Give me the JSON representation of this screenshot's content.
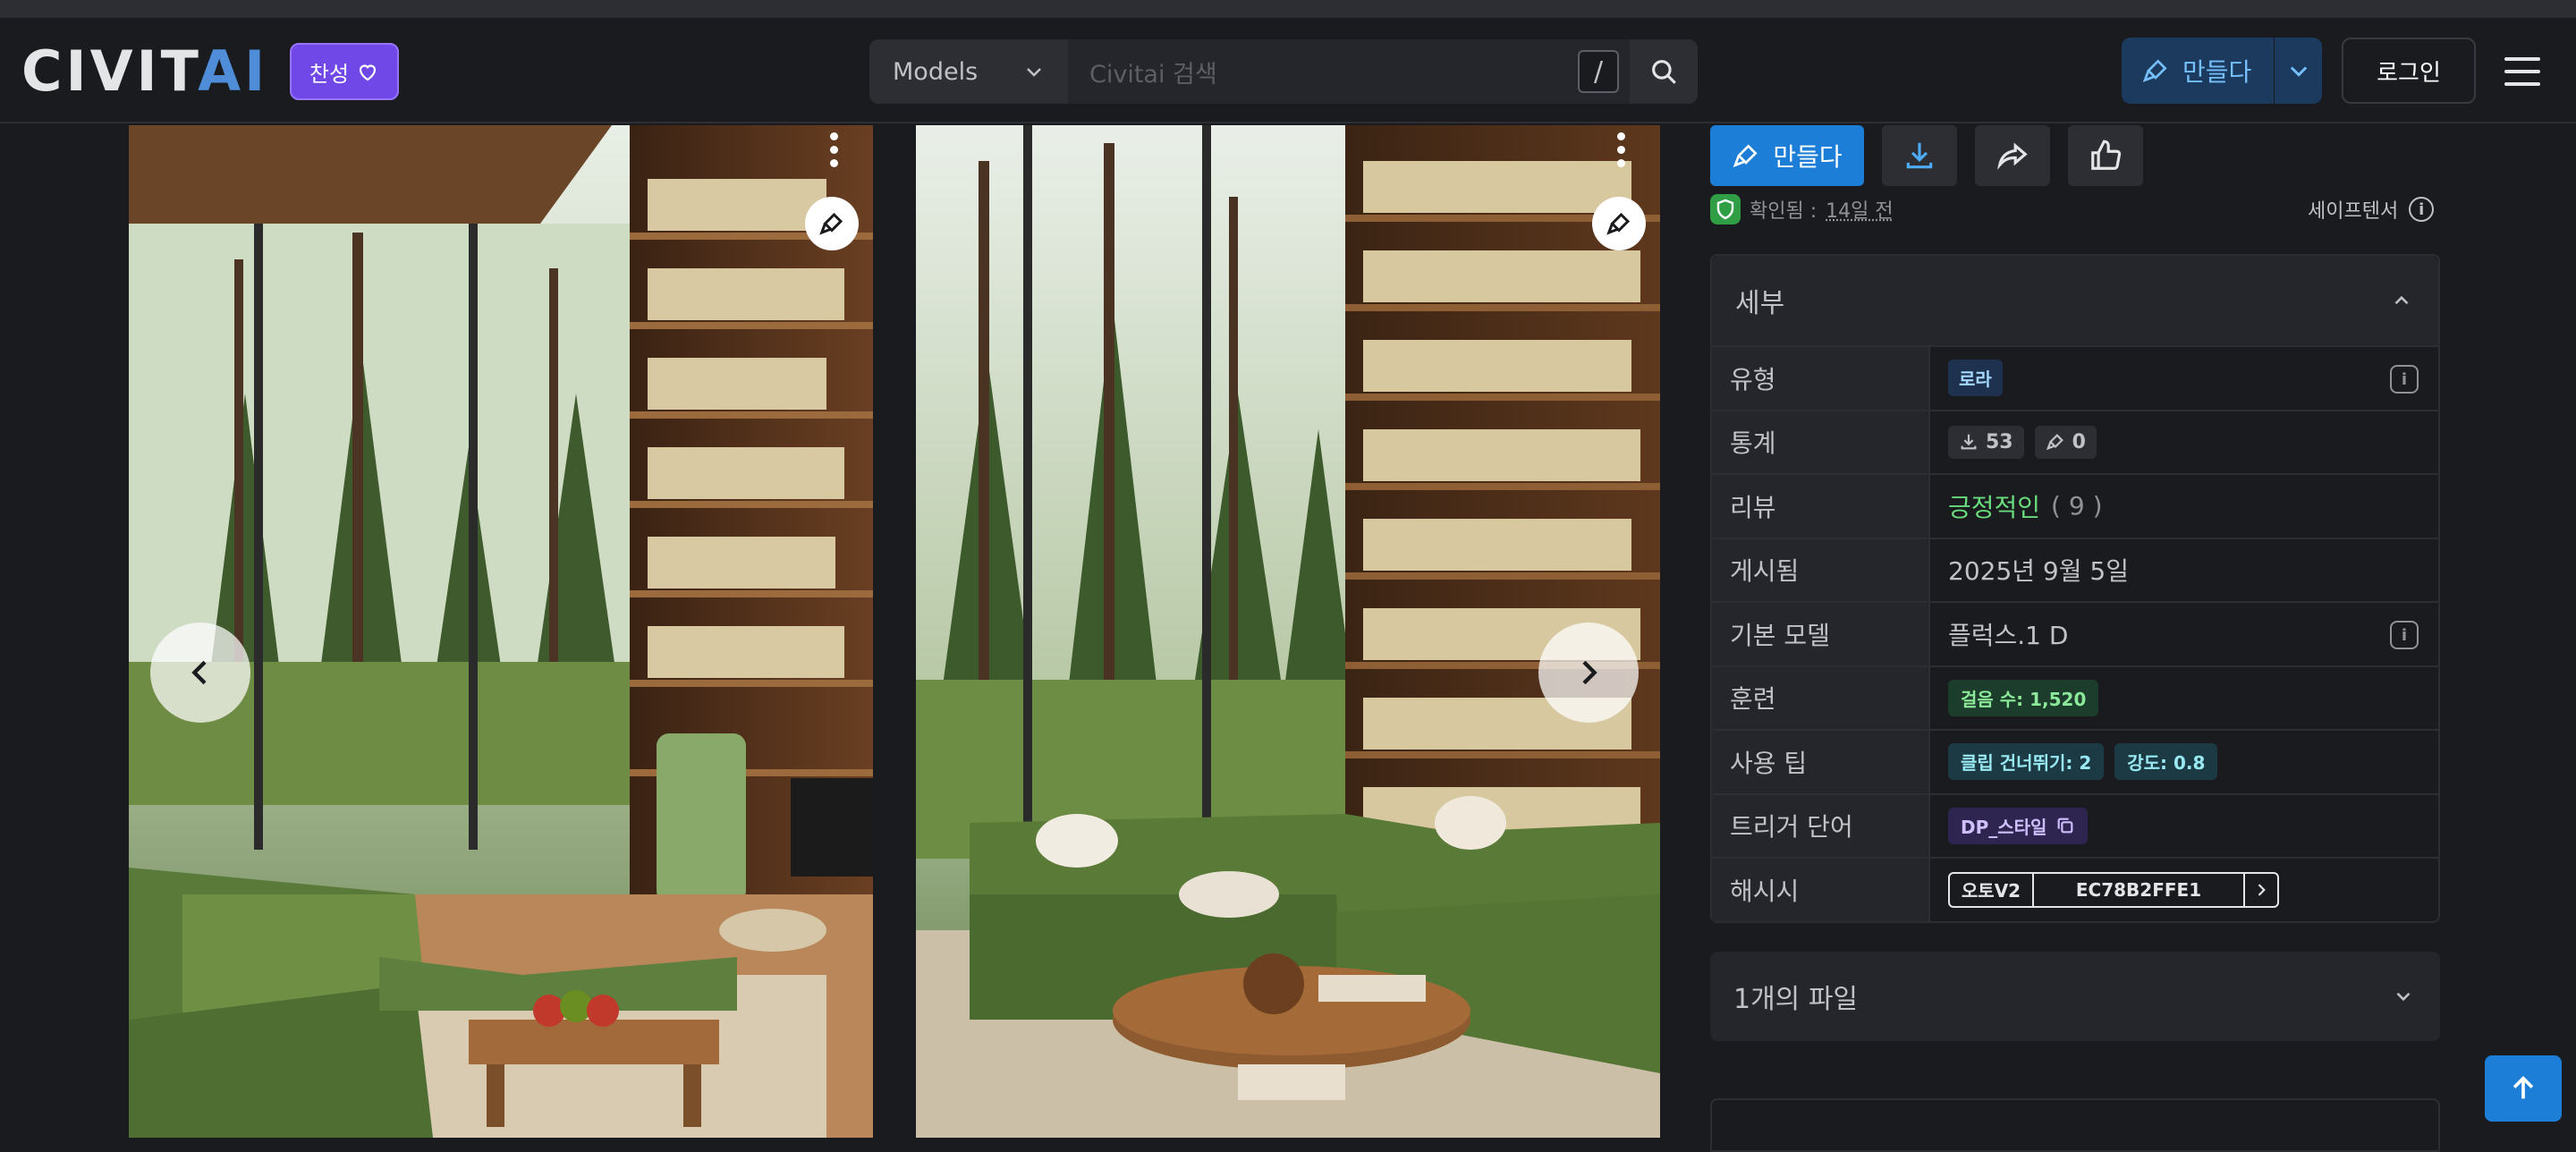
{
  "header": {
    "logo_main": "CIVIT",
    "logo_accent": "AI",
    "support_label": "찬성",
    "search_category": "Models",
    "search_placeholder": "Civitai 검색",
    "search_shortcut": "/",
    "create_label": "만들다",
    "login_label": "로그인"
  },
  "actions": {
    "create_label": "만들다"
  },
  "verification": {
    "label": "확인됨 :",
    "time": "14일 전",
    "format": "세이프텐서"
  },
  "details": {
    "title": "세부",
    "rows": [
      {
        "key": "유형",
        "value": "로라"
      },
      {
        "key": "통계",
        "downloads": "53",
        "generations": "0"
      },
      {
        "key": "리뷰",
        "sentiment": "긍정적인",
        "count": "( 9 )"
      },
      {
        "key": "게시됨",
        "value": "2025년 9월 5일"
      },
      {
        "key": "기본 모델",
        "value": "플럭스.1 D"
      },
      {
        "key": "훈련",
        "value": "걸음 수: 1,520"
      },
      {
        "key": "사용 팁",
        "clip_skip": "클립 건너뛰기: 2",
        "strength": "강도: 0.8"
      },
      {
        "key": "트리거 단어",
        "value": "DP_스타일"
      },
      {
        "key": "해시시",
        "hash_type": "오토V2",
        "hash_value": "EC78B2FFE1"
      }
    ]
  },
  "files": {
    "title": "1개의 파일"
  },
  "colors": {
    "accent": "#1c7ed6",
    "brand_purple": "#7048e8",
    "positive": "#69db7c",
    "background": "#1a1b1e"
  }
}
